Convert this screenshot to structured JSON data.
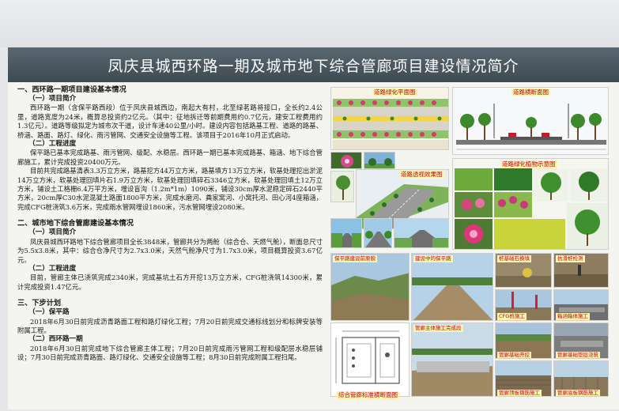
{
  "title": "凤庆县城西环路一期及城市地下综合管廊项目建设情况简介",
  "section1": {
    "heading": "一、西环路一期项目建设基本情况",
    "sub1": "（一）项目简介",
    "p1": "西环路一期（含保平路西段）位于凤庆县城西边，南起大有村，北至绿茗路将接口，全长约2.4公里，道路宽度为24米，概算总投资约2亿元。（其中：征地拆迁等前期费用约0.7亿元，建安工程费用约1.3亿元）。道路等级拟定为城市次干道，设计车速40公里/小时。建设内容包括路基工程、道路的路基、桥涵、路面、路灯、绿化、雨污管网、交通安全设施等工程。该项目于2016年10月正式启动。",
    "sub2": "（二）工程进度",
    "p2": "保平路已基本完成路基、雨污管网、级配、水稳层。西环路一期已基本完成路基、箱涵、地下综合管廊施工，累计完成投资20400万元。",
    "p3": "目前共完成路基清表3.3万立方米，路基挖方44万立方米，路基填方13万立方米，软基处理挖出淤泥14万立方米，软基处理回填片石1.9万立方米，软基处理回填碎石3346立方米，软基处理回填土12万立方米，铺设土工格栅6.4万平方米，埋设盲沟（1.2m*1m）1090米，铺设30cm厚水泥稳定碎石2440平方米，20cm厚C30水泥混凝土路面1800平方米，完成水磨河、粪家窝河、小窝托河、田心河4座箱涵，完成CFG桩浇筑3.6万米，完成雨水管网埋设1860米，污水管网埋设2080米。"
  },
  "section2": {
    "heading": "二、城市地下综合管廊建设基本情况",
    "sub1": "（一）项目简介",
    "p1": "凤庆县城西环路地下综合管廊项目全长3848米，管廊共分为两舱（综合仓、天燃气舱），断面总尺寸为5.5x3.8米，其中：综合仓净尺寸为2.7x3.0米，天然气舱净尺寸为1.7x3.0米，项目概算投资3.67亿元。",
    "sub2": "（二）工程进度",
    "p2": "目前，管廊主体已浇筑完成2340米，完成基坑土石方开挖13万立方米，CFG桩浇筑14300米，累计完成投资1.47亿元。"
  },
  "section3": {
    "heading": "三、下步计划",
    "sub1": "（一）保平路",
    "p1": "2018年6月30日前完成沥青路面工程和路灯绿化工程；7月20日前完成交通标线划分和标牌安装等附属工程。",
    "sub2": "（二）西环路一期",
    "p2": "2018年6月30日前完成地下综合管廊主体工程；7月20日前完成雨污管网工程和级配层水稳层铺设；7月30日前完成沥青路面、路灯绿化、交通安全设施等工程；8月30日前完成附属工程扫尾。"
  },
  "labels": {
    "plan": "道路绿化平面图",
    "section": "道路横断面图",
    "perspective": "道路透视效果图",
    "plants": "道路绿化植物示意图",
    "baoping_construction": "保平路建设前原貌",
    "baoping_building": "建设中的保平路",
    "pile_ground": "桩基础石换填",
    "corridor_build": "抗滑桩检测",
    "cfg": "CFG桩施工",
    "box_culvert": "箱涵箱体施工",
    "corridor_body": "管廊主体施工完成段",
    "corridor_foundation": "管廊基础开挖",
    "corridor_box": "管廊基础垫层浇筑",
    "cross_section": "综合管廊标准横断面图",
    "rebar_tie": "管廊顶板钢筋施工",
    "base_rebar": "管廊底板钢筋施工"
  },
  "colors": {
    "title_bg": "#46525a",
    "label_text": "#c0002a",
    "label_bg": "#fff6a8"
  }
}
